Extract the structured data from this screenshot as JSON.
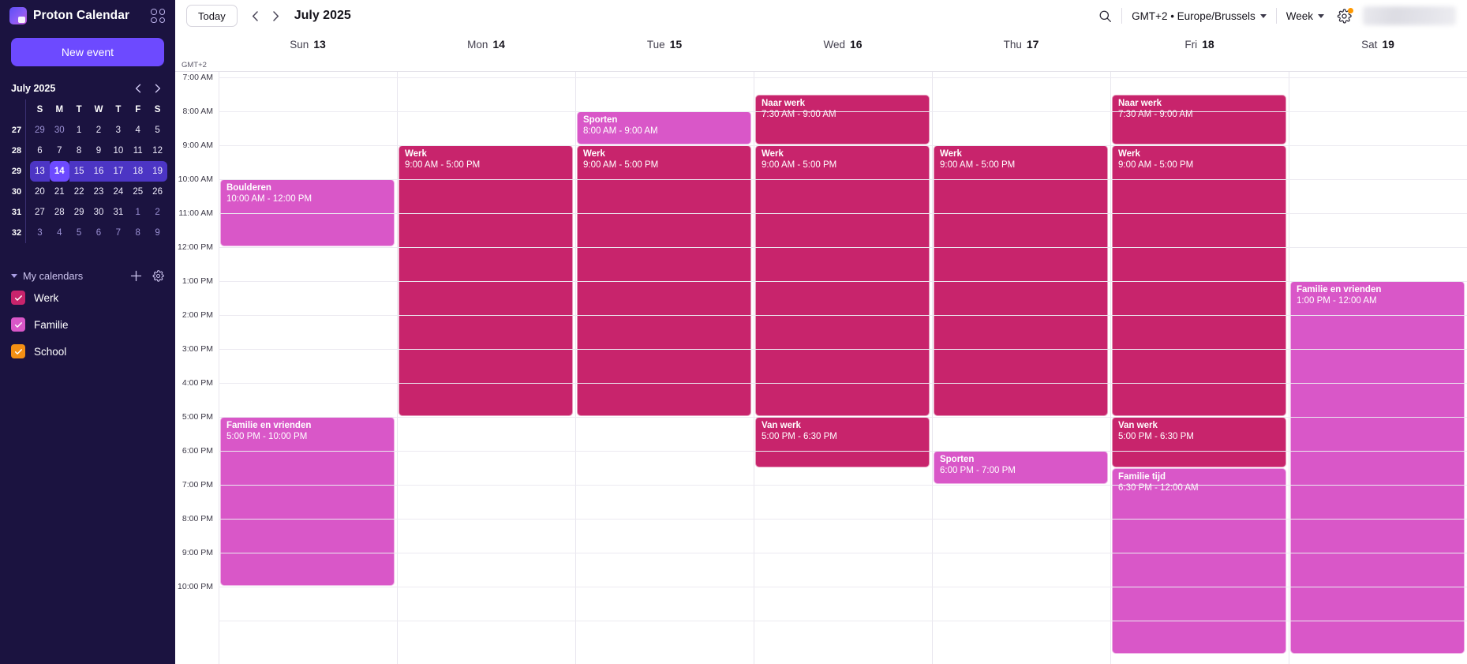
{
  "app": {
    "brand": "Proton Calendar",
    "apps_grid_icon": "apps-grid-icon",
    "new_event_label": "New event"
  },
  "topbar": {
    "today_label": "Today",
    "prev_icon": "chevron-left-icon",
    "next_icon": "chevron-right-icon",
    "date_title": "July 2025",
    "search_icon": "search-icon",
    "timezone_label": "GMT+2 • Europe/Brussels",
    "view_label": "Week",
    "settings_icon": "gear-icon",
    "notification_dot_color": "#ff9900"
  },
  "mini_calendar": {
    "title": "July 2025",
    "prev_icon": "chevron-left-icon",
    "next_icon": "chevron-right-icon",
    "dow": [
      "S",
      "M",
      "T",
      "W",
      "T",
      "F",
      "S"
    ],
    "weeks": [
      {
        "week_no": "27",
        "days": [
          "29",
          "30",
          "1",
          "2",
          "3",
          "4",
          "5"
        ],
        "muted": [
          true,
          true,
          false,
          false,
          false,
          false,
          false
        ],
        "in_selected_week": false,
        "today_index": -1
      },
      {
        "week_no": "28",
        "days": [
          "6",
          "7",
          "8",
          "9",
          "10",
          "11",
          "12"
        ],
        "muted": [
          false,
          false,
          false,
          false,
          false,
          false,
          false
        ],
        "in_selected_week": false,
        "today_index": -1
      },
      {
        "week_no": "29",
        "days": [
          "13",
          "14",
          "15",
          "16",
          "17",
          "18",
          "19"
        ],
        "muted": [
          false,
          false,
          false,
          false,
          false,
          false,
          false
        ],
        "in_selected_week": true,
        "today_index": 1
      },
      {
        "week_no": "30",
        "days": [
          "20",
          "21",
          "22",
          "23",
          "24",
          "25",
          "26"
        ],
        "muted": [
          false,
          false,
          false,
          false,
          false,
          false,
          false
        ],
        "in_selected_week": false,
        "today_index": -1
      },
      {
        "week_no": "31",
        "days": [
          "27",
          "28",
          "29",
          "30",
          "31",
          "1",
          "2"
        ],
        "muted": [
          false,
          false,
          false,
          false,
          false,
          true,
          true
        ],
        "in_selected_week": false,
        "today_index": -1
      },
      {
        "week_no": "32",
        "days": [
          "3",
          "4",
          "5",
          "6",
          "7",
          "8",
          "9"
        ],
        "muted": [
          true,
          true,
          true,
          true,
          true,
          true,
          true
        ],
        "in_selected_week": false,
        "today_index": -1
      }
    ]
  },
  "calendars_panel": {
    "title": "My calendars",
    "caret_icon": "caret-down-icon",
    "add_icon": "plus-icon",
    "settings_icon": "gear-icon",
    "items": [
      {
        "name": "Werk",
        "color": "#c8246c",
        "checked": true
      },
      {
        "name": "Familie",
        "color": "#d957c8",
        "checked": true
      },
      {
        "name": "School",
        "color": "#f59014",
        "checked": true
      }
    ]
  },
  "week_view": {
    "timezone_label": "GMT+2",
    "days": [
      {
        "dayname": "Sun",
        "daynum": "13"
      },
      {
        "dayname": "Mon",
        "daynum": "14"
      },
      {
        "dayname": "Tue",
        "daynum": "15"
      },
      {
        "dayname": "Wed",
        "daynum": "16"
      },
      {
        "dayname": "Thu",
        "daynum": "17"
      },
      {
        "dayname": "Fri",
        "daynum": "18"
      },
      {
        "dayname": "Sat",
        "daynum": "19"
      }
    ],
    "hour_labels": [
      "7:00 AM",
      "8:00 AM",
      "9:00 AM",
      "10:00 AM",
      "11:00 AM",
      "12:00 PM",
      "1:00 PM",
      "2:00 PM",
      "3:00 PM",
      "4:00 PM",
      "5:00 PM",
      "6:00 PM",
      "7:00 PM",
      "8:00 PM",
      "9:00 PM",
      "10:00 PM"
    ],
    "first_hour": 7,
    "hour_height": 43,
    "events": [
      {
        "day": 0,
        "title": "Boulderen",
        "time": "10:00 AM - 12:00 PM",
        "start": 10,
        "end": 12,
        "color": "#d957c8",
        "calendar": "Familie"
      },
      {
        "day": 0,
        "title": "Familie en vrienden",
        "time": "5:00 PM - 10:00 PM",
        "start": 17,
        "end": 22,
        "color": "#d957c8",
        "calendar": "Familie"
      },
      {
        "day": 1,
        "title": "Werk",
        "time": "9:00 AM - 5:00 PM",
        "start": 9,
        "end": 17,
        "color": "#c8246c",
        "calendar": "Werk"
      },
      {
        "day": 2,
        "title": "Sporten",
        "time": "8:00 AM - 9:00 AM",
        "start": 8,
        "end": 9,
        "color": "#d957c8",
        "calendar": "Familie"
      },
      {
        "day": 2,
        "title": "Werk",
        "time": "9:00 AM - 5:00 PM",
        "start": 9,
        "end": 17,
        "color": "#c8246c",
        "calendar": "Werk"
      },
      {
        "day": 3,
        "title": "Naar werk",
        "time": "7:30 AM - 9:00 AM",
        "start": 7.5,
        "end": 9,
        "color": "#c8246c",
        "calendar": "Werk"
      },
      {
        "day": 3,
        "title": "Werk",
        "time": "9:00 AM - 5:00 PM",
        "start": 9,
        "end": 17,
        "color": "#c8246c",
        "calendar": "Werk"
      },
      {
        "day": 3,
        "title": "Van werk",
        "time": "5:00 PM - 6:30 PM",
        "start": 17,
        "end": 18.5,
        "color": "#c8246c",
        "calendar": "Werk"
      },
      {
        "day": 4,
        "title": "Werk",
        "time": "9:00 AM - 5:00 PM",
        "start": 9,
        "end": 17,
        "color": "#c8246c",
        "calendar": "Werk"
      },
      {
        "day": 4,
        "title": "Sporten",
        "time": "6:00 PM - 7:00 PM",
        "start": 18,
        "end": 19,
        "color": "#d957c8",
        "calendar": "Familie"
      },
      {
        "day": 5,
        "title": "Naar werk",
        "time": "7:30 AM - 9:00 AM",
        "start": 7.5,
        "end": 9,
        "color": "#c8246c",
        "calendar": "Werk"
      },
      {
        "day": 5,
        "title": "Werk",
        "time": "9:00 AM - 5:00 PM",
        "start": 9,
        "end": 17,
        "color": "#c8246c",
        "calendar": "Werk"
      },
      {
        "day": 5,
        "title": "Van werk",
        "time": "5:00 PM - 6:30 PM",
        "start": 17,
        "end": 18.5,
        "color": "#c8246c",
        "calendar": "Werk"
      },
      {
        "day": 5,
        "title": "Familie tijd",
        "time": "6:30 PM - 12:00 AM",
        "start": 18.5,
        "end": 24,
        "color": "#d957c8",
        "calendar": "Familie"
      },
      {
        "day": 6,
        "title": "Familie en vrienden",
        "time": "1:00 PM - 12:00 AM",
        "start": 13,
        "end": 24,
        "color": "#d957c8",
        "calendar": "Familie"
      }
    ]
  }
}
